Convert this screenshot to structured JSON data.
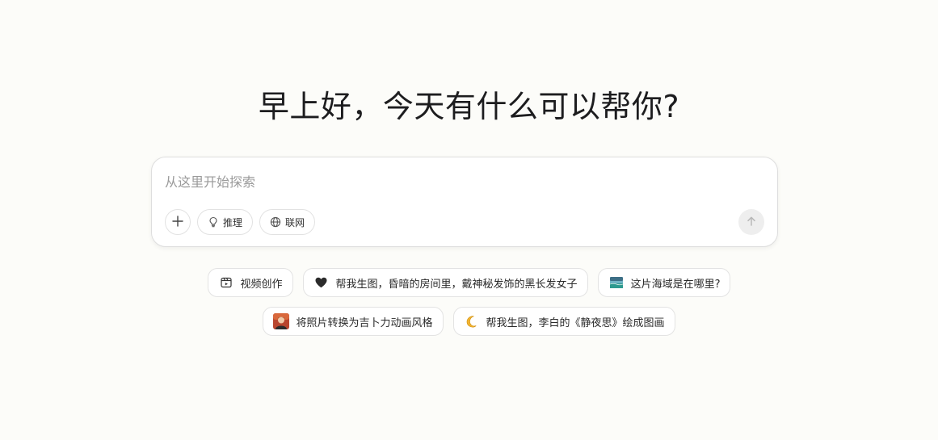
{
  "greeting": "早上好，今天有什么可以帮你?",
  "composer": {
    "placeholder": "从这里开始探索",
    "value": "",
    "tools": {
      "add_icon": "plus-icon",
      "reasoning_label": "推理",
      "reasoning_icon": "lightbulb-icon",
      "web_label": "联网",
      "web_icon": "globe-icon",
      "send_icon": "arrow-up-icon"
    }
  },
  "suggestions": {
    "row1": [
      {
        "label": "视频创作",
        "icon": "video-clip-icon"
      },
      {
        "label": "帮我生图，昏暗的房间里，戴神秘发饰的黑长发女子",
        "icon": "black-heart-icon"
      },
      {
        "label": "这片海域是在哪里?",
        "icon": "seascape-thumbnail-icon"
      }
    ],
    "row2": [
      {
        "label": "将照片转换为吉卜力动画风格",
        "icon": "portrait-thumbnail-icon"
      },
      {
        "label": "帮我生图，李白的《静夜思》绘成图画",
        "icon": "crescent-moon-icon"
      }
    ]
  },
  "colors": {
    "background": "#fcfcf9",
    "border": "#e2e2e2",
    "send_disabled": "#eeeeee"
  }
}
